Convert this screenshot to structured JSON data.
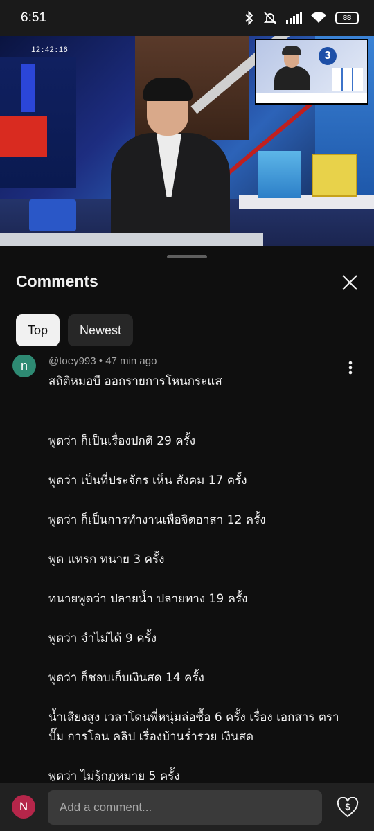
{
  "status_bar": {
    "time": "6:51",
    "battery_level": "88",
    "icons": [
      "bluetooth-icon",
      "bell-muted-icon",
      "signal-icon",
      "wifi-icon",
      "battery-icon"
    ]
  },
  "video": {
    "timecode": "12:42:16"
  },
  "comments_panel": {
    "title": "Comments",
    "close_icon": "close-icon",
    "filters": [
      {
        "label": "Top",
        "selected": true
      },
      {
        "label": "Newest",
        "selected": false
      }
    ]
  },
  "comment": {
    "avatar_letter": "n",
    "author": "@toey993",
    "separator": "•",
    "time": "47 min ago",
    "lines": [
      "สถิติหมอบี ออกรายการโหนกระแส",
      "",
      "",
      "พูดว่า ก็เป็นเรื่องปกติ 29 ครั้ง",
      "",
      "พูดว่า เป็นที่ประจักร เห็น สังคม 17 ครั้ง",
      "",
      "พูดว่า ก็เป็นการทำงานเพื่อจิตอาสา 12 ครั้ง",
      "",
      "พูด แทรก ทนาย 3  ครั้ง",
      "",
      "ทนายพูดว่า ปลายน้ำ ปลายทาง 19 ครั้ง",
      "",
      "พูดว่า จำไม่ได้ 9 ครั้ง",
      "",
      "พูดว่า ก็ชอบเก็บเงินสด  14 ครั้ง",
      "",
      "น้ำเสียงสูง เวลาโดนพี่หนุ่มล่อซื้อ  6  ครั้ง เรื่อง เอกสาร ตราปั๊ม การโอน คลิป เรื่องบ้านร่ำรวย เงินสด",
      "",
      "พูดว่า ไม่รู้กฏหมาย  5 ครั้ง"
    ]
  },
  "composer": {
    "avatar_letter": "N",
    "placeholder": "Add a comment...",
    "thanks_icon": "super-thanks-icon"
  }
}
